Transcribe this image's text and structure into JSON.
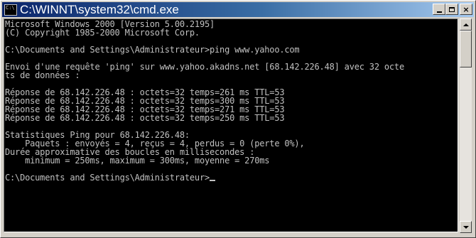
{
  "window": {
    "icon_text": "C:\\",
    "title": "C:\\WINNT\\system32\\cmd.exe",
    "buttons": {
      "minimize": "_",
      "maximize": "□",
      "close": "×"
    }
  },
  "console": {
    "lines": [
      "Microsoft Windows 2000 [Version 5.00.2195]",
      "(C) Copyright 1985-2000 Microsoft Corp.",
      "",
      "C:\\Documents and Settings\\Administrateur>ping www.yahoo.com",
      "",
      "Envoi d'une requête 'ping' sur www.yahoo.akadns.net [68.142.226.48] avec 32 octe",
      "ts de données :",
      "",
      "Réponse de 68.142.226.48 : octets=32 temps=261 ms TTL=53",
      "Réponse de 68.142.226.48 : octets=32 temps=300 ms TTL=53",
      "Réponse de 68.142.226.48 : octets=32 temps=271 ms TTL=53",
      "Réponse de 68.142.226.48 : octets=32 temps=250 ms TTL=53",
      "",
      "Statistiques Ping pour 68.142.226.48:",
      "    Paquets : envoyés = 4, reçus = 4, perdus = 0 (perte 0%),",
      "Durée approximative des boucles en millisecondes :",
      "    minimum = 250ms, maximum = 300ms, moyenne = 270ms",
      "",
      "C:\\Documents and Settings\\Administrateur>"
    ],
    "colors": {
      "background": "#000000",
      "text": "#c0c0c0"
    }
  },
  "titlebar_colors": {
    "start": "#0a246a",
    "end": "#a6caf0"
  }
}
